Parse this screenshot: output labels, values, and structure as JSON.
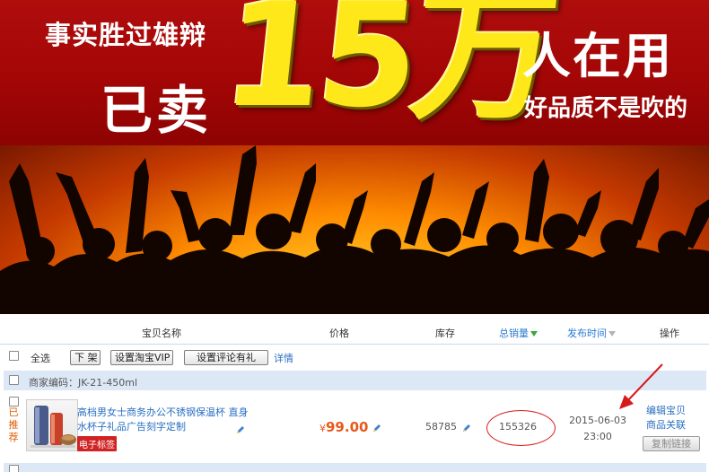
{
  "banner": {
    "line1": "事实胜过雄辩",
    "line2": "已卖",
    "big_number": "15万",
    "people": "人在用",
    "tagline": "好品质不是吹的"
  },
  "table": {
    "headers": {
      "name": "宝贝名称",
      "price": "价格",
      "stock": "库存",
      "sales": "总销量",
      "date": "发布时间",
      "ops": "操作"
    },
    "toolbar": {
      "select_all": "全选",
      "btn_delist": "下 架",
      "btn_vip": "设置淘宝VIP",
      "btn_review": "设置评论有礼",
      "details_link": "详情"
    },
    "group": {
      "merchant_code": "商家编码：JK-21-450ml"
    },
    "item": {
      "recommend_label": "已推荐",
      "title_line1": "高档男女士商务办公不锈钢保温杯 直身",
      "title_line2": "水杯子礼品广告刻字定制",
      "tag": "电子标签",
      "price_currency": "¥",
      "price": "99.00",
      "stock": "58785",
      "sales": "155326",
      "date": "2015-06-03",
      "time": "23:00",
      "op_edit": "编辑宝贝",
      "op_related": "商品关联",
      "op_copy": "复制链接"
    }
  },
  "colors": {
    "banner_red": "#a30606",
    "highlight_yellow": "#ffe81a",
    "link_blue": "#2a6fc1",
    "price_orange": "#e8581a",
    "annotation_red": "#d61b1b"
  }
}
